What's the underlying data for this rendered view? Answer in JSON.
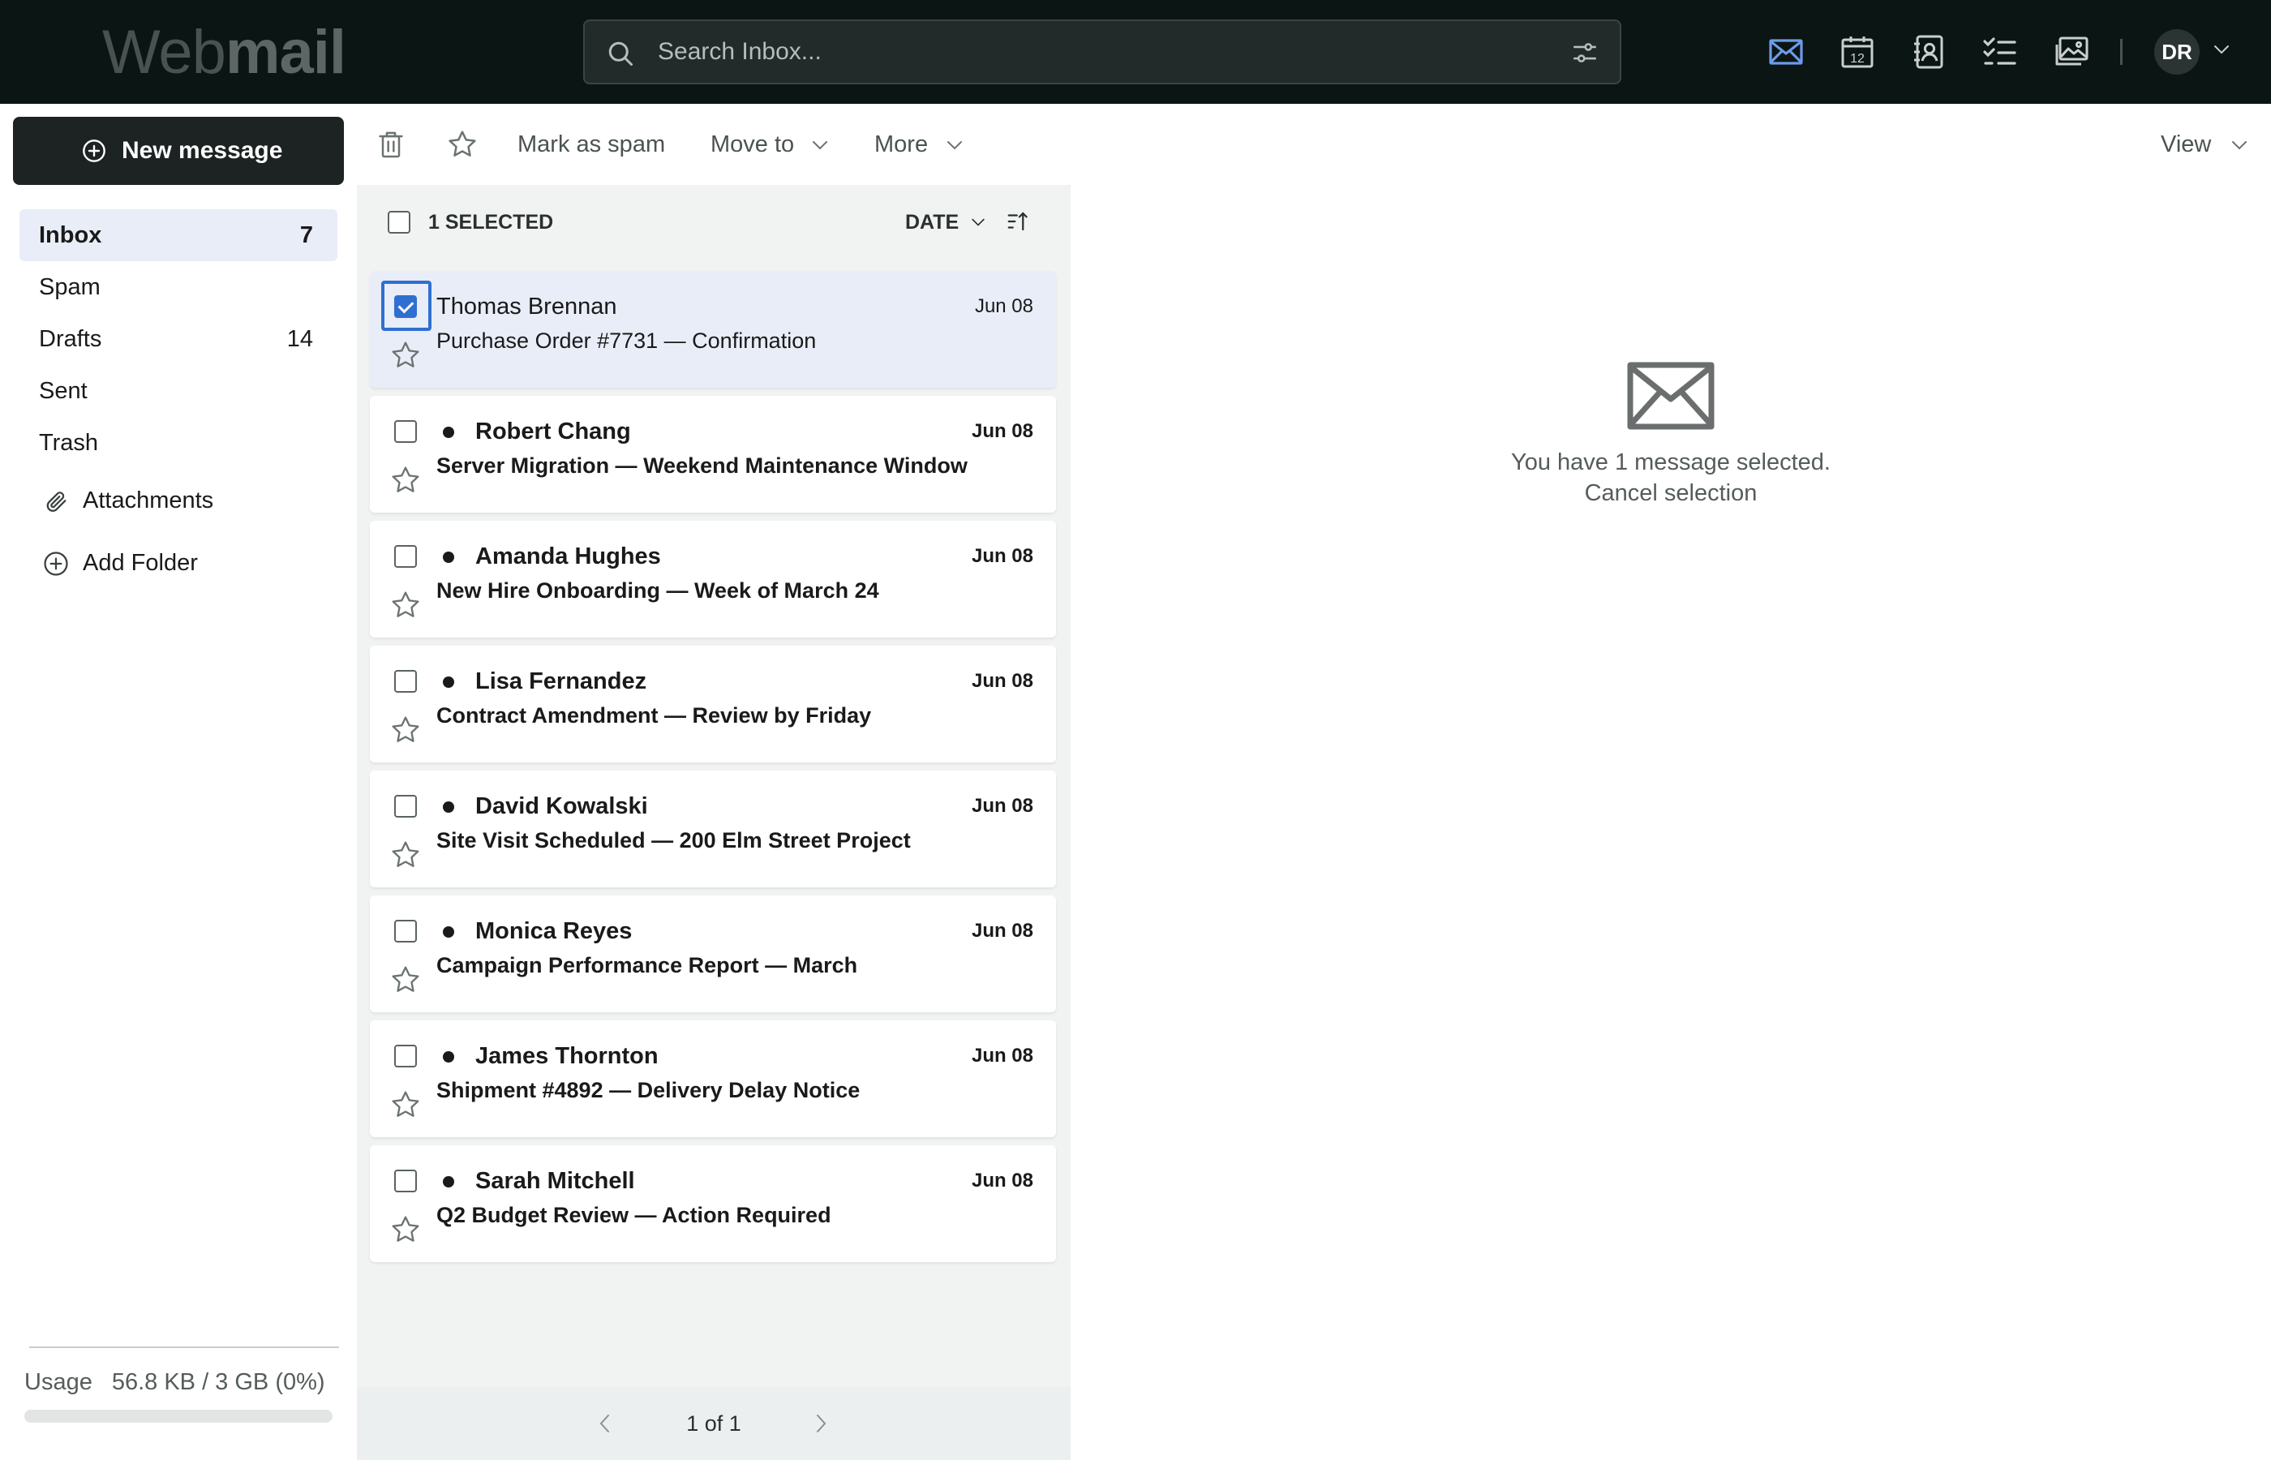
{
  "app": {
    "logo_light": "Web",
    "logo_bold": "mail"
  },
  "search": {
    "placeholder": "Search Inbox..."
  },
  "header": {
    "apps": [
      "mail-icon",
      "calendar-icon",
      "contacts-icon",
      "tasks-icon",
      "photos-icon"
    ],
    "calendar_day": "12",
    "avatar_initials": "DR"
  },
  "sidebar": {
    "new_message_label": "New message",
    "folders": [
      {
        "label": "Inbox",
        "count": "7",
        "active": true
      },
      {
        "label": "Spam",
        "count": ""
      },
      {
        "label": "Drafts",
        "count": "14"
      },
      {
        "label": "Sent",
        "count": ""
      },
      {
        "label": "Trash",
        "count": ""
      }
    ],
    "attachments_label": "Attachments",
    "add_folder_label": "Add Folder",
    "usage_label": "Usage",
    "usage_value": "56.8 KB / 3 GB (0%)",
    "usage_fraction": 0
  },
  "toolbar": {
    "mark_spam_label": "Mark as spam",
    "move_to_label": "Move to",
    "more_label": "More",
    "view_label": "View"
  },
  "list": {
    "selected_label": "1 SELECTED",
    "sort_label": "DATE",
    "messages": [
      {
        "sender": "Thomas Brennan",
        "subject": "Purchase Order #7731 — Confirmation",
        "date": "Jun 08",
        "unread": false,
        "selected": true
      },
      {
        "sender": "Robert Chang",
        "subject": "Server Migration — Weekend Maintenance Window",
        "date": "Jun 08",
        "unread": true,
        "selected": false
      },
      {
        "sender": "Amanda Hughes",
        "subject": "New Hire Onboarding — Week of March 24",
        "date": "Jun 08",
        "unread": true,
        "selected": false
      },
      {
        "sender": "Lisa Fernandez",
        "subject": "Contract Amendment — Review by Friday",
        "date": "Jun 08",
        "unread": true,
        "selected": false
      },
      {
        "sender": "David Kowalski",
        "subject": "Site Visit Scheduled — 200 Elm Street Project",
        "date": "Jun 08",
        "unread": true,
        "selected": false
      },
      {
        "sender": "Monica Reyes",
        "subject": "Campaign Performance Report — March",
        "date": "Jun 08",
        "unread": true,
        "selected": false
      },
      {
        "sender": "James Thornton",
        "subject": "Shipment #4892 — Delivery Delay Notice",
        "date": "Jun 08",
        "unread": true,
        "selected": false
      },
      {
        "sender": "Sarah Mitchell",
        "subject": "Q2 Budget Review — Action Required",
        "date": "Jun 08",
        "unread": true,
        "selected": false
      }
    ],
    "pager_text": "1 of 1"
  },
  "pane": {
    "message": "You have 1 message selected.",
    "cancel_label": "Cancel selection"
  },
  "colors": {
    "topbar": "#0b1514",
    "accent": "#2f6fd1",
    "active_mail_icon": "#6d9bea",
    "selected_row": "#e9edf8"
  }
}
